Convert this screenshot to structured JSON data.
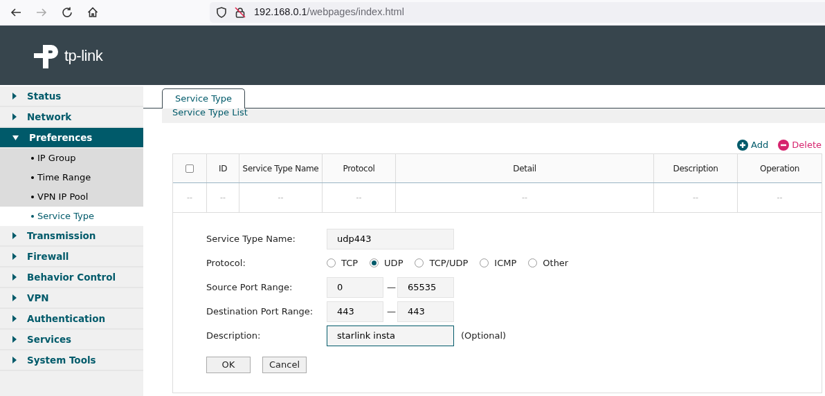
{
  "browser": {
    "url_host": "192.168.0.1",
    "url_path": "/webpages/index.html"
  },
  "header": {
    "brand": "tp-link"
  },
  "sidebar": {
    "items": [
      {
        "label": "Status",
        "expanded": false
      },
      {
        "label": "Network",
        "expanded": false
      },
      {
        "label": "Preferences",
        "expanded": true,
        "children": [
          {
            "label": "IP Group",
            "selected": false
          },
          {
            "label": "Time Range",
            "selected": false
          },
          {
            "label": "VPN IP Pool",
            "selected": false
          },
          {
            "label": "Service Type",
            "selected": true
          }
        ]
      },
      {
        "label": "Transmission",
        "expanded": false
      },
      {
        "label": "Firewall",
        "expanded": false
      },
      {
        "label": "Behavior Control",
        "expanded": false
      },
      {
        "label": "VPN",
        "expanded": false
      },
      {
        "label": "Authentication",
        "expanded": false
      },
      {
        "label": "Services",
        "expanded": false
      },
      {
        "label": "System Tools",
        "expanded": false
      }
    ]
  },
  "tabs": [
    {
      "label": "Service Type",
      "selected": true
    }
  ],
  "section_title": "Service Type List",
  "actions": [
    {
      "kind": "add",
      "label": "Add"
    },
    {
      "kind": "delete",
      "label": "Delete"
    }
  ],
  "table": {
    "select_all_checked": false,
    "columns": [
      "",
      "ID",
      "Service Type Name",
      "Protocol",
      "Detail",
      "Description",
      "Operation"
    ],
    "rows": [
      [
        "--",
        "--",
        "--",
        "--",
        "--",
        "--",
        "--"
      ]
    ]
  },
  "form": {
    "fields": [
      {
        "kind": "text",
        "label": "Service Type Name:",
        "value": "udp443",
        "focused": false
      },
      {
        "kind": "radio",
        "label": "Protocol:",
        "options": [
          {
            "label": "TCP",
            "selected": false
          },
          {
            "label": "UDP",
            "selected": true
          },
          {
            "label": "TCP/UDP",
            "selected": false
          },
          {
            "label": "ICMP",
            "selected": false
          },
          {
            "label": "Other",
            "selected": false
          }
        ]
      },
      {
        "kind": "range",
        "label": "Source Port Range:",
        "from": "0",
        "separator": "—",
        "to": "65535"
      },
      {
        "kind": "range",
        "label": "Destination Port Range:",
        "from": "443",
        "separator": "—",
        "to": "443"
      },
      {
        "kind": "text",
        "label": "Description:",
        "value": "starlink insta",
        "focused": true,
        "note": "(Optional)"
      }
    ],
    "buttons": [
      "OK",
      "Cancel"
    ]
  }
}
